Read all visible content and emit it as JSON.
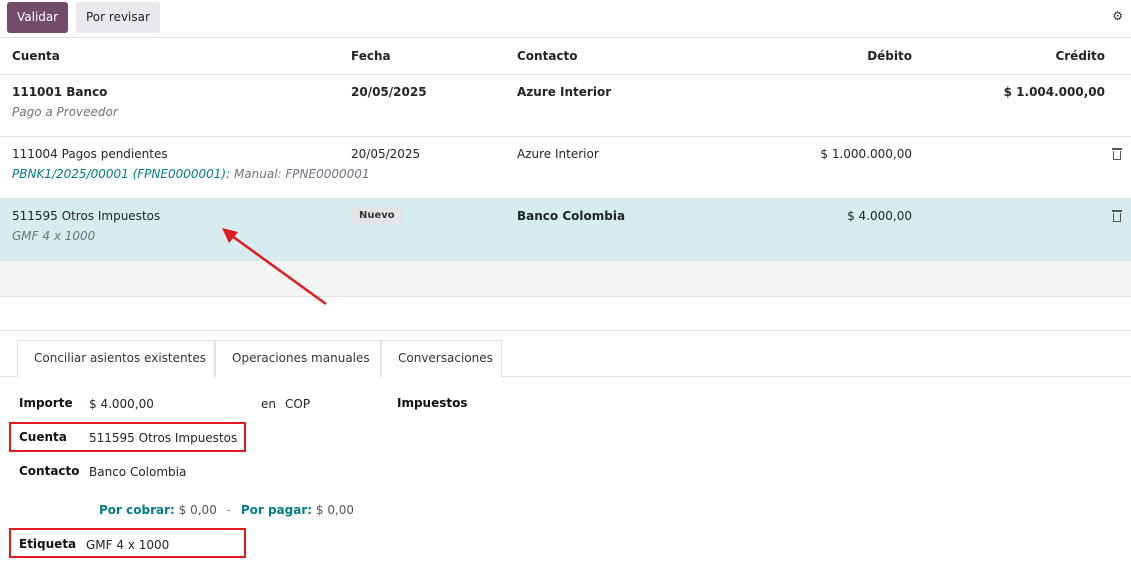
{
  "toolbar": {
    "validate_label": "Validar",
    "review_label": "Por revisar",
    "settings_icon": "gear-icon"
  },
  "table": {
    "headers": {
      "cuenta": "Cuenta",
      "fecha": "Fecha",
      "contacto": "Contacto",
      "debito": "Débito",
      "credito": "Crédito"
    },
    "rows": [
      {
        "account": "111001 Banco",
        "label": "Pago a Proveedor",
        "date": "20/05/2025",
        "partner": "Azure Interior",
        "debit": "",
        "credit": "$ 1.004.000,00"
      },
      {
        "account": "111004 Pagos pendientes",
        "ref": "PBNK1/2025/00001 (FPNE0000001):",
        "label": "Manual: FPNE0000001",
        "date": "20/05/2025",
        "partner": "Azure Interior",
        "debit": "$ 1.000.000,00",
        "credit": ""
      },
      {
        "account": "511595 Otros Impuestos",
        "label": "GMF 4 x 1000",
        "badge": "Nuevo",
        "partner": "Banco Colombia",
        "debit": "$ 4.000,00",
        "credit": ""
      }
    ]
  },
  "tabs": [
    {
      "label": "Conciliar asientos existentes"
    },
    {
      "label": "Operaciones manuales",
      "active": true
    },
    {
      "label": "Conversaciones"
    }
  ],
  "form": {
    "amount_label": "Importe",
    "amount_value": "$ 4.000,00",
    "currency_prefix": "en",
    "currency": "COP",
    "taxes_label": "Impuestos",
    "account_label": "Cuenta",
    "account_value": "511595 Otros Impuestos",
    "partner_label": "Contacto",
    "partner_value": "Banco Colombia",
    "receivable_label": "Por cobrar:",
    "receivable_value": "$ 0,00",
    "separator": "-",
    "payable_label": "Por pagar:",
    "payable_value": "$ 0,00",
    "tag_label": "Etiqueta",
    "tag_value": "GMF 4 x 1000"
  },
  "colors": {
    "primary": "#714B67",
    "selected_row": "#d7ecf1",
    "link_teal": "#017e84",
    "annotation_red": "#e01b1b"
  }
}
